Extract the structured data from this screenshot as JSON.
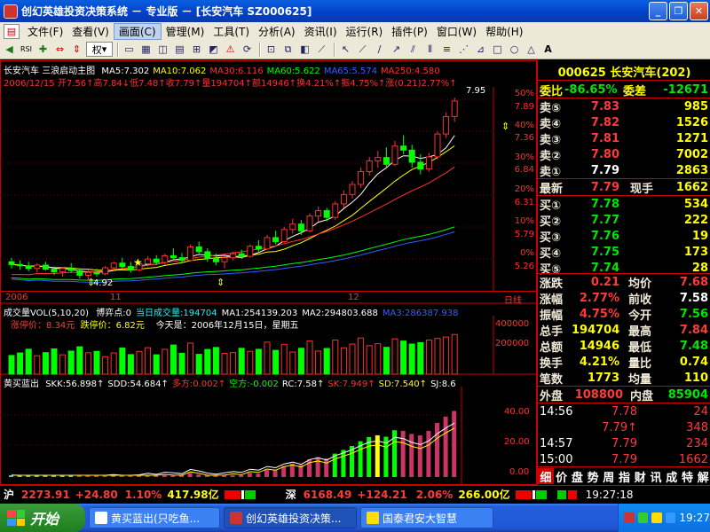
{
  "window": {
    "title": "创幻英雄投资决策系统 － 专业版 － [长安汽车 SZ000625]",
    "buttons": [
      "_",
      "❐",
      "✕"
    ]
  },
  "menu": [
    "文件(F)",
    "查看(V)",
    "画面(C)",
    "管理(M)",
    "工具(T)",
    "分析(A)",
    "资讯(I)",
    "运行(R)",
    "插件(P)",
    "窗口(W)",
    "帮助(H)"
  ],
  "toolbar": {
    "rights_select": "权"
  },
  "chart": {
    "stock_name": "长安汽车",
    "indicator_name": "三浪启动主图",
    "ma_line": [
      {
        "label": "MA5:7.302",
        "color": "#ffffff"
      },
      {
        "label": "MA10:7.062",
        "color": "#ffff00"
      },
      {
        "label": "MA30:6.116",
        "color": "#ff3030"
      },
      {
        "label": "MA60:5.622",
        "color": "#00ff00"
      },
      {
        "label": "MA65:5.574",
        "color": "#3060ff"
      },
      {
        "label": "MA250:4.580",
        "color": "#ff3030"
      }
    ],
    "info_line": "2006/12/15 开7.56↑高7.84↓低7.48↑收7.79↑量194704↑额14946↑换4.21%↑振4.75%↑涨(0.21)2.77%↑",
    "high_label": "7.95",
    "low_label": "4.92",
    "price_ticks": [
      "7.89",
      "7.36",
      "6.84",
      "6.31",
      "5.79",
      "5.26"
    ],
    "pct_ticks": [
      "50%",
      "40%",
      "30%",
      "20%",
      "10%",
      "0%"
    ],
    "date_labels": [
      "2006",
      "11",
      "12",
      "日线"
    ],
    "vol_title": "成交量VOL(5,10,20)",
    "vol_items": [
      {
        "label": "博弈点:0",
        "color": "#ffffff"
      },
      {
        "label": "当日成交量:194704",
        "color": "#00ffff"
      },
      {
        "label": "MA1:254139.203",
        "color": "#ffffff"
      },
      {
        "label": "MA2:294803.688",
        "color": "#ffffff"
      },
      {
        "label": "MA3:286387.938",
        "color": "#3060ff"
      }
    ],
    "limit_up": "涨停价：8.34元",
    "limit_down": "跌停价：6.82元",
    "today": "今天是：2006年12月15日，星期五",
    "vol_ticks": [
      "400000",
      "200000"
    ],
    "ind_title": "黄买蓝出",
    "ind_items": [
      {
        "label": "SKK:56.898↑",
        "color": "#ffffff"
      },
      {
        "label": "SDD:54.684↑",
        "color": "#ffffff"
      },
      {
        "label": "多方:0.002↑",
        "color": "#ff3030"
      },
      {
        "label": "空方:-0.002",
        "color": "#00ff00"
      },
      {
        "label": "RC:7.58↑",
        "color": "#ffffff"
      },
      {
        "label": "SK:7.949↑",
        "color": "#ff3030"
      },
      {
        "label": "SD:7.540↑",
        "color": "#ffff00"
      },
      {
        "label": "SJ:8.6",
        "color": "#ffffff"
      }
    ],
    "ind_ticks": [
      "40.00",
      "20.00",
      "0.00"
    ]
  },
  "chart_data": {
    "type": "candlestick",
    "note": "approximate recent-session daily candles for 000625",
    "ohlc": [
      [
        5.4,
        5.46,
        5.3,
        5.36
      ],
      [
        5.36,
        5.42,
        5.28,
        5.34
      ],
      [
        5.34,
        5.4,
        5.26,
        5.3
      ],
      [
        5.3,
        5.38,
        5.24,
        5.35
      ],
      [
        5.35,
        5.4,
        5.27,
        5.29
      ],
      [
        5.29,
        5.33,
        5.2,
        5.25
      ],
      [
        5.25,
        5.32,
        5.18,
        5.3
      ],
      [
        5.3,
        5.38,
        5.24,
        5.27
      ],
      [
        5.27,
        5.3,
        5.15,
        5.2
      ],
      [
        5.2,
        5.28,
        5.12,
        5.24
      ],
      [
        5.24,
        5.3,
        5.18,
        5.22
      ],
      [
        5.22,
        5.34,
        5.2,
        5.31
      ],
      [
        5.31,
        5.4,
        5.26,
        5.38
      ],
      [
        5.38,
        5.46,
        5.3,
        5.33
      ],
      [
        5.33,
        5.4,
        5.24,
        5.28
      ],
      [
        5.28,
        5.4,
        5.25,
        5.37
      ],
      [
        5.37,
        5.48,
        5.33,
        5.44
      ],
      [
        5.44,
        5.5,
        5.36,
        5.39
      ],
      [
        5.39,
        5.52,
        5.35,
        5.49
      ],
      [
        5.49,
        5.6,
        5.42,
        5.46
      ],
      [
        5.46,
        5.53,
        5.38,
        5.42
      ],
      [
        5.42,
        5.66,
        5.4,
        5.62
      ],
      [
        5.62,
        5.7,
        5.52,
        5.55
      ],
      [
        5.55,
        5.6,
        5.4,
        5.45
      ],
      [
        5.45,
        5.52,
        5.35,
        5.4
      ],
      [
        5.4,
        5.48,
        5.3,
        5.46
      ],
      [
        5.46,
        5.55,
        5.42,
        5.52
      ],
      [
        5.52,
        5.58,
        5.44,
        5.48
      ],
      [
        5.48,
        5.66,
        5.46,
        5.63
      ],
      [
        5.63,
        5.72,
        5.55,
        5.59
      ],
      [
        5.59,
        5.8,
        5.57,
        5.76
      ],
      [
        5.76,
        5.86,
        5.66,
        5.7
      ],
      [
        5.7,
        5.92,
        5.68,
        5.88
      ],
      [
        5.88,
        6.04,
        5.82,
        5.96
      ],
      [
        5.96,
        6.02,
        5.8,
        5.86
      ],
      [
        5.86,
        6.12,
        5.84,
        6.08
      ],
      [
        6.08,
        6.22,
        6.0,
        6.16
      ],
      [
        6.16,
        6.2,
        6.0,
        6.06
      ],
      [
        6.06,
        6.3,
        6.02,
        6.26
      ],
      [
        6.26,
        6.46,
        6.2,
        6.4
      ],
      [
        6.4,
        6.6,
        6.34,
        6.55
      ],
      [
        6.55,
        6.8,
        6.5,
        6.74
      ],
      [
        6.74,
        6.96,
        6.68,
        6.9
      ],
      [
        6.9,
        7.05,
        6.8,
        6.95
      ],
      [
        6.95,
        7.1,
        6.8,
        6.85
      ],
      [
        6.85,
        7.2,
        6.82,
        7.12
      ],
      [
        7.12,
        7.28,
        7.0,
        7.06
      ],
      [
        7.06,
        7.14,
        6.8,
        6.88
      ],
      [
        6.88,
        7.0,
        6.7,
        6.78
      ],
      [
        6.78,
        7.02,
        6.74,
        6.96
      ],
      [
        6.96,
        7.34,
        6.92,
        7.3
      ],
      [
        7.3,
        7.62,
        7.24,
        7.56
      ],
      [
        7.56,
        7.84,
        7.48,
        7.79
      ]
    ],
    "ylim": [
      5.1,
      8.0
    ]
  },
  "panel": {
    "code_name": "000625 长安汽车(202)",
    "weibi_label": "委比",
    "weibi_value": "-86.65%",
    "weicha_label": "委差",
    "weicha_value": "-12671",
    "sells": [
      {
        "label": "卖⑤",
        "price": "7.83",
        "vol": "985"
      },
      {
        "label": "卖④",
        "price": "7.82",
        "vol": "1526"
      },
      {
        "label": "卖③",
        "price": "7.81",
        "vol": "1271"
      },
      {
        "label": "卖②",
        "price": "7.80",
        "vol": "7002"
      },
      {
        "label": "卖①",
        "price": "7.79",
        "vol": "2863"
      }
    ],
    "latest_label": "最新",
    "latest_price": "7.79",
    "xianshou_label": "现手",
    "xianshou_value": "1662",
    "buys": [
      {
        "label": "买①",
        "price": "7.78",
        "vol": "534"
      },
      {
        "label": "买②",
        "price": "7.77",
        "vol": "222"
      },
      {
        "label": "买③",
        "price": "7.76",
        "vol": "19"
      },
      {
        "label": "买④",
        "price": "7.75",
        "vol": "173"
      },
      {
        "label": "买⑤",
        "price": "7.74",
        "vol": "28"
      }
    ],
    "stats": [
      {
        "l1": "涨跌",
        "v1": "0.21",
        "c1": "red",
        "l2": "均价",
        "v2": "7.68",
        "c2": "red"
      },
      {
        "l1": "涨幅",
        "v1": "2.77%",
        "c1": "red",
        "l2": "前收",
        "v2": "7.58",
        "c2": "wht"
      },
      {
        "l1": "振幅",
        "v1": "4.75%",
        "c1": "red",
        "l2": "今开",
        "v2": "7.56",
        "c2": "grn"
      },
      {
        "l1": "总手",
        "v1": "194704",
        "c1": "yel",
        "l2": "最高",
        "v2": "7.84",
        "c2": "red"
      },
      {
        "l1": "总额",
        "v1": "14946",
        "c1": "yel",
        "l2": "最低",
        "v2": "7.48",
        "c2": "grn"
      },
      {
        "l1": "换手",
        "v1": "4.21%",
        "c1": "yel",
        "l2": "量比",
        "v2": "0.74",
        "c2": "yel"
      },
      {
        "l1": "笔数",
        "v1": "1773",
        "c1": "yel",
        "l2": "均量",
        "v2": "110",
        "c2": "yel"
      }
    ],
    "waipan_label": "外盘",
    "waipan_value": "108800",
    "neipan_label": "内盘",
    "neipan_value": "85904",
    "ticks": [
      {
        "time": "14:56",
        "price": "7.78",
        "vol": "24"
      },
      {
        "time": "",
        "price": "7.79↑",
        "vol": "348"
      },
      {
        "time": "14:57",
        "price": "7.79",
        "vol": "234"
      },
      {
        "time": "15:00",
        "price": "7.79",
        "vol": "1662"
      }
    ],
    "tabs": [
      "细",
      "价",
      "盘",
      "势",
      "周",
      "指",
      "财",
      "讯",
      "成",
      "特",
      "解"
    ]
  },
  "status": {
    "sh_label": "沪",
    "sh_index": "2273.91",
    "sh_change": "+24.80",
    "sh_pct": "1.10%",
    "sh_amount": "417.98亿",
    "sz_label": "深",
    "sz_index": "6168.49",
    "sz_change": "+124.21",
    "sz_pct": "2.06%",
    "sz_amount": "266.00亿",
    "time": "19:27:18"
  },
  "taskbar": {
    "start": "开始",
    "tasks": [
      {
        "label": "黄买蓝出(只吃鱼...",
        "active": false
      },
      {
        "label": "创幻英雄投资决策...",
        "active": true
      },
      {
        "label": "国泰君安大智慧",
        "active": false
      }
    ],
    "clock": "19:27"
  }
}
